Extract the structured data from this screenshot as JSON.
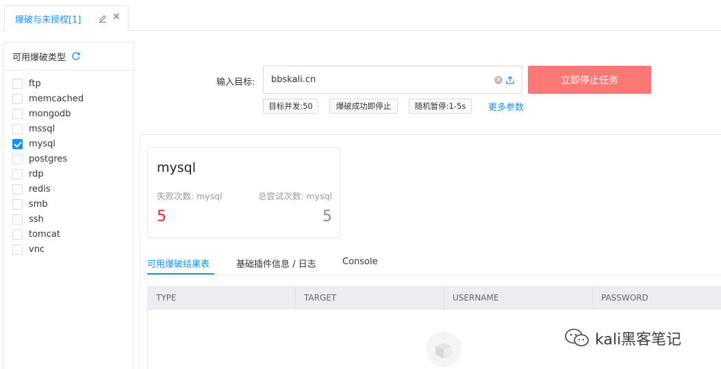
{
  "tabbar": {
    "tab_title": "爆破与未授权[1]"
  },
  "sidebar": {
    "header": "可用爆破类型",
    "items": [
      {
        "label": "ftp",
        "checked": false
      },
      {
        "label": "memcached",
        "checked": false
      },
      {
        "label": "mongodb",
        "checked": false
      },
      {
        "label": "mssql",
        "checked": false
      },
      {
        "label": "mysql",
        "checked": true
      },
      {
        "label": "postgres",
        "checked": false
      },
      {
        "label": "rdp",
        "checked": false
      },
      {
        "label": "redis",
        "checked": false
      },
      {
        "label": "smb",
        "checked": false
      },
      {
        "label": "ssh",
        "checked": false
      },
      {
        "label": "tomcat",
        "checked": false
      },
      {
        "label": "vnc",
        "checked": false
      }
    ]
  },
  "target": {
    "label": "输入目标:",
    "value": "bbskali.cn",
    "stop_label": "立即停止任务"
  },
  "params": {
    "concurrency": "目标并发:50",
    "stop_on_success": "爆破成功即停止",
    "random_pause": "随机暂停:1-5s",
    "more": "更多参数"
  },
  "stat_card": {
    "title": "mysql",
    "fail_label": "失败次数: mysql",
    "total_label": "总尝试次数: mysql",
    "fail_value": "5",
    "total_value": "5"
  },
  "result_tabs": [
    "可用爆破结果表",
    "基础插件信息 / 日志",
    "Console"
  ],
  "table": {
    "columns": [
      "TYPE",
      "TARGET",
      "USERNAME",
      "PASSWORD"
    ]
  },
  "watermark": {
    "text": "kali黑客笔记"
  },
  "colors": {
    "accent": "#1890ff",
    "stop_button": "#ff7875",
    "fail_value": "#f5222d"
  }
}
